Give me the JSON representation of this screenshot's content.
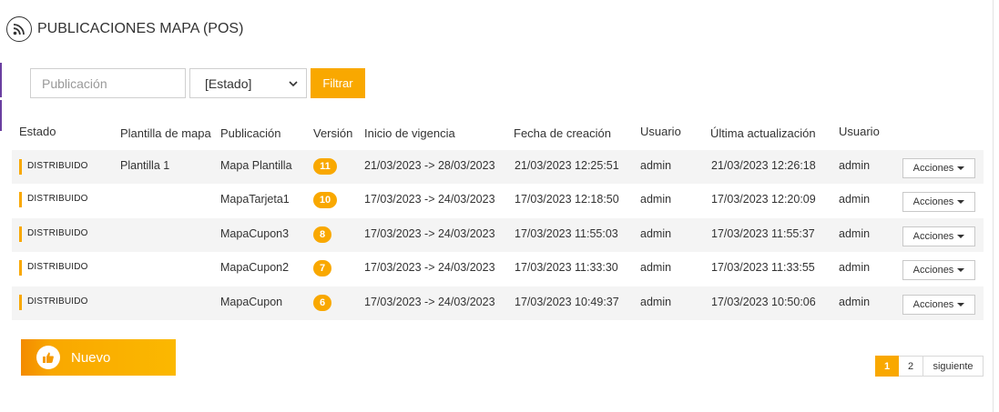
{
  "header": {
    "title": "PUBLICACIONES MAPA (POS)",
    "icon": "rss-icon"
  },
  "filters": {
    "publication_placeholder": "Publicación",
    "publication_value": "",
    "state_selected": "[Estado]",
    "filter_button": "Filtrar"
  },
  "table": {
    "headers": {
      "estado": "Estado",
      "plantilla": "Plantilla de mapa",
      "publicacion": "Publicación",
      "version": "Versión",
      "inicio": "Inicio de vigencia",
      "creacion": "Fecha de creación",
      "usuario1": "Usuario",
      "actualizacion": "Última actualización",
      "usuario2": "Usuario"
    },
    "rows": [
      {
        "estado": "DISTRIBUIDO",
        "plantilla": "Plantilla 1",
        "publicacion": "Mapa Plantilla",
        "version": "11",
        "vigencia": "21/03/2023 -> 28/03/2023",
        "creacion": "21/03/2023 12:25:51",
        "usuario": "admin",
        "actualizacion": "21/03/2023 12:26:18",
        "usuario2": "admin",
        "acciones": "Acciones"
      },
      {
        "estado": "DISTRIBUIDO",
        "plantilla": "",
        "publicacion": "MapaTarjeta1",
        "version": "10",
        "vigencia": "17/03/2023 -> 24/03/2023",
        "creacion": "17/03/2023 12:18:50",
        "usuario": "admin",
        "actualizacion": "17/03/2023 12:20:09",
        "usuario2": "admin",
        "acciones": "Acciones"
      },
      {
        "estado": "DISTRIBUIDO",
        "plantilla": "",
        "publicacion": "MapaCupon3",
        "version": "8",
        "vigencia": "17/03/2023 -> 24/03/2023",
        "creacion": "17/03/2023 11:55:03",
        "usuario": "admin",
        "actualizacion": "17/03/2023 11:55:37",
        "usuario2": "admin",
        "acciones": "Acciones"
      },
      {
        "estado": "DISTRIBUIDO",
        "plantilla": "",
        "publicacion": "MapaCupon2",
        "version": "7",
        "vigencia": "17/03/2023 -> 24/03/2023",
        "creacion": "17/03/2023 11:33:30",
        "usuario": "admin",
        "actualizacion": "17/03/2023 11:33:55",
        "usuario2": "admin",
        "acciones": "Acciones"
      },
      {
        "estado": "DISTRIBUIDO",
        "plantilla": "",
        "publicacion": "MapaCupon",
        "version": "6",
        "vigencia": "17/03/2023 -> 24/03/2023",
        "creacion": "17/03/2023 10:49:37",
        "usuario": "admin",
        "actualizacion": "17/03/2023 10:50:06",
        "usuario2": "admin",
        "acciones": "Acciones"
      }
    ]
  },
  "new_button": {
    "label": "Nuevo",
    "icon": "thumbs-up-icon"
  },
  "pagination": {
    "pages": [
      "1",
      "2"
    ],
    "current": "1",
    "next": "siguiente"
  },
  "colors": {
    "accent": "#f9a800",
    "stripe": "#6a3fa0",
    "row_alt": "#f4f4f4"
  }
}
